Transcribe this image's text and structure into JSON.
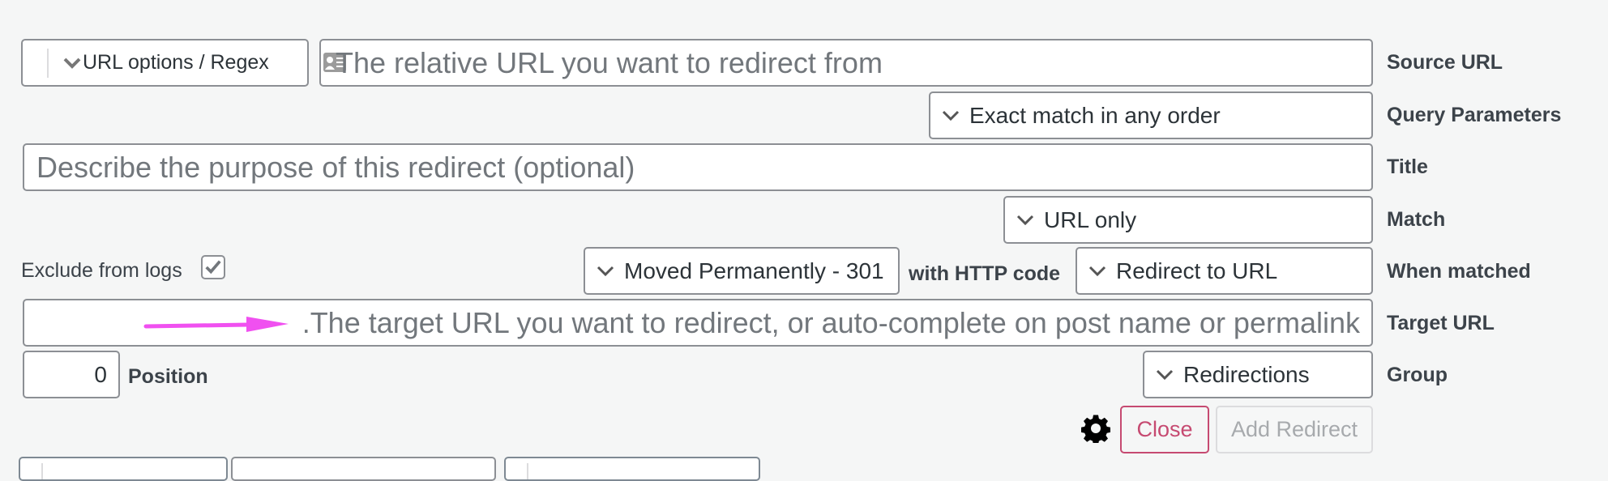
{
  "source": {
    "options_select": "URL options / Regex",
    "placeholder": "The relative URL you want to redirect from",
    "label": "Source URL"
  },
  "query_params": {
    "value": "Exact match in any order",
    "label": "Query Parameters"
  },
  "title": {
    "placeholder": "Describe the purpose of this redirect (optional)",
    "label": "Title"
  },
  "match": {
    "value": "URL only",
    "label": "Match"
  },
  "when_matched": {
    "exclude_label": "Exclude from logs",
    "exclude_checked": true,
    "http_code": "Moved Permanently - 301",
    "http_code_label": "with HTTP code",
    "action": "Redirect to URL",
    "label": "When matched"
  },
  "target": {
    "placeholder": ".The target URL you want to redirect, or auto-complete on post name or permalink",
    "label": "Target URL",
    "annotation_color": "#f050f0"
  },
  "position": {
    "value": "0",
    "label": "Position"
  },
  "group": {
    "value": "Redirections",
    "label": "Group"
  },
  "actions": {
    "close_label": "Close",
    "add_label": "Add Redirect",
    "close_color": "#c64a71"
  }
}
